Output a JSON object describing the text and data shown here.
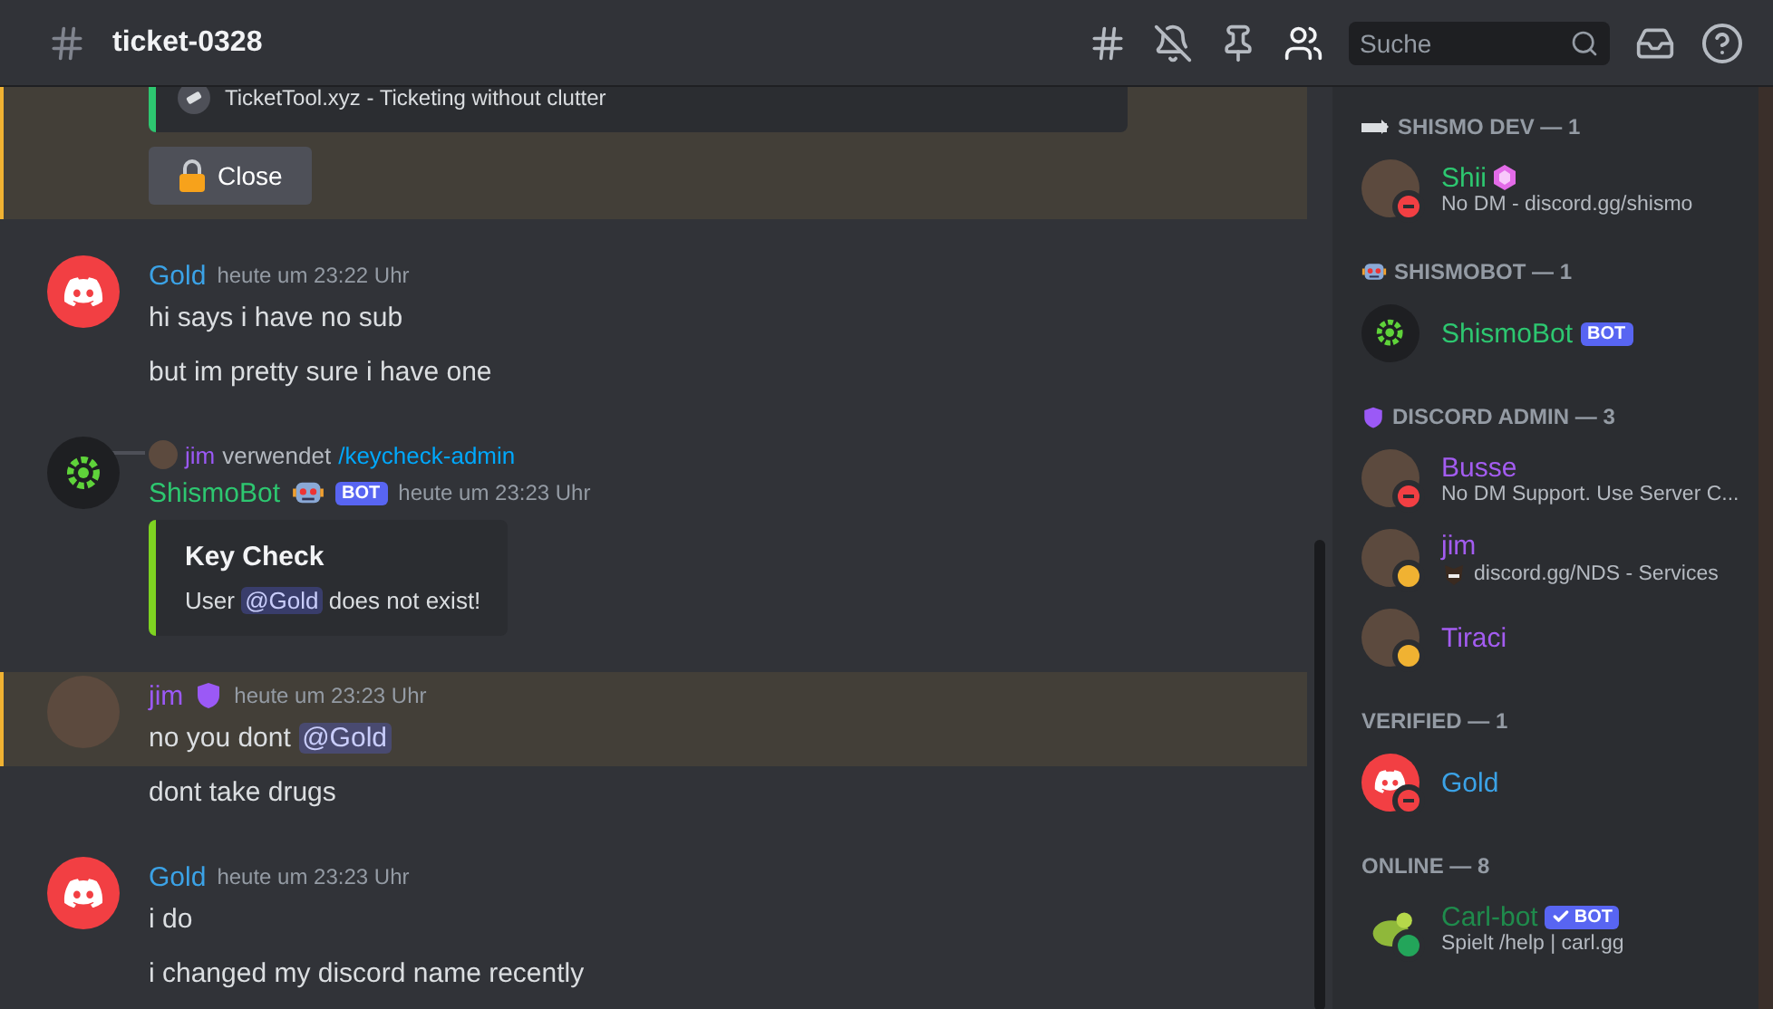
{
  "channel": {
    "name": "ticket-0328"
  },
  "search": {
    "placeholder": "Suche"
  },
  "messages": [
    {
      "kind": "embed_tail",
      "highlighted": true,
      "footer": "TicketTool.xyz - Ticketing without clutter",
      "button": "Close"
    },
    {
      "kind": "message",
      "author": "Gold",
      "color": "#3ba2e6",
      "timestamp": "heute um 23:22 Uhr",
      "highlighted": false,
      "lines": [
        [
          {
            "kind": "text",
            "text": "hi says i have no sub"
          }
        ],
        [
          {
            "kind": "text",
            "text": "but im pretty sure i have one"
          }
        ]
      ]
    },
    {
      "kind": "command",
      "invoker": "jim",
      "verb": "verwendet",
      "command": "/keycheck-admin",
      "author": "ShismoBot",
      "color": "#2dc770",
      "bot_tag": "BOT",
      "timestamp": "heute um 23:23 Uhr",
      "embed": {
        "title": "Key Check",
        "parts": [
          {
            "kind": "text",
            "text": "User "
          },
          {
            "kind": "mention",
            "text": "@Gold"
          },
          {
            "kind": "text",
            "text": " does not exist!"
          }
        ]
      }
    },
    {
      "kind": "message",
      "author": "jim",
      "color": "#9b59f6",
      "timestamp": "heute um 23:23 Uhr",
      "highlighted": true,
      "lines": [
        [
          {
            "kind": "text",
            "text": "no you dont "
          },
          {
            "kind": "mention",
            "text": "@Gold"
          }
        ],
        [
          {
            "kind": "text",
            "text": "dont take drugs"
          }
        ]
      ]
    },
    {
      "kind": "message",
      "author": "Gold",
      "color": "#3ba2e6",
      "timestamp": "heute um 23:23 Uhr",
      "highlighted": false,
      "lines": [
        [
          {
            "kind": "text",
            "text": "i do"
          }
        ],
        [
          {
            "kind": "text",
            "text": "i changed my discord name recently"
          }
        ]
      ]
    }
  ],
  "member_groups": [
    {
      "title": "SHISMO DEV — 1",
      "members": [
        {
          "name": "Shii",
          "color": "#2dc770",
          "status": "No DM - discord.gg/shismo"
        }
      ]
    },
    {
      "title": "SHISMOBOT — 1",
      "members": [
        {
          "name": "ShismoBot",
          "color": "#2dc770",
          "bot_tag": "BOT",
          "verified": false
        }
      ]
    },
    {
      "title": "DISCORD ADMIN — 3",
      "members": [
        {
          "name": "Busse",
          "color": "#a35cf0",
          "status": "No DM Support. Use Server C..."
        },
        {
          "name": "jim",
          "color": "#a35cf0",
          "status": "discord.gg/NDS - Services"
        },
        {
          "name": "Tiraci",
          "color": "#a35cf0"
        }
      ]
    },
    {
      "title": "VERIFIED — 1",
      "members": [
        {
          "name": "Gold",
          "color": "#3ba2e6"
        }
      ]
    },
    {
      "title": "ONLINE — 8",
      "members": [
        {
          "name": "Carl-bot",
          "color": "#1f8b4c",
          "bot_tag": "BOT",
          "verified": true,
          "status": "Spielt /help | carl.gg"
        }
      ]
    }
  ]
}
